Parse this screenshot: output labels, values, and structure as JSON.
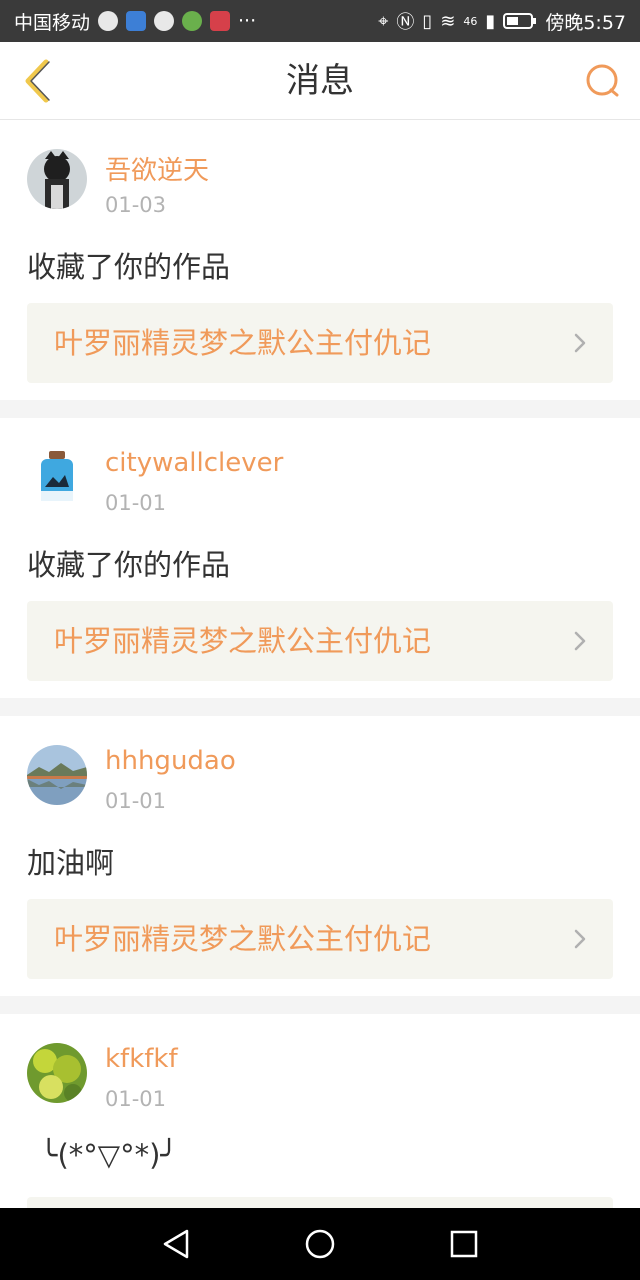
{
  "status_bar": {
    "carrier": "中国移动",
    "more": "···",
    "network": "46",
    "time": "傍晚5:57"
  },
  "header": {
    "title": "消息",
    "accent_color": "#f09a5a"
  },
  "messages": [
    {
      "username": "吾欲逆天",
      "date": "01-03",
      "action": "收藏了你的作品",
      "work_title": "叶罗丽精灵梦之默公主付仇记"
    },
    {
      "username": "citywallclever",
      "date": "01-01",
      "action": "收藏了你的作品",
      "work_title": "叶罗丽精灵梦之默公主付仇记"
    },
    {
      "username": "hhhgudao",
      "date": "01-01",
      "action": "加油啊",
      "work_title": "叶罗丽精灵梦之默公主付仇记"
    },
    {
      "username": "kfkfkf",
      "date": "01-01",
      "action": "╰(*°▽°*)╯",
      "work_title": ""
    }
  ]
}
